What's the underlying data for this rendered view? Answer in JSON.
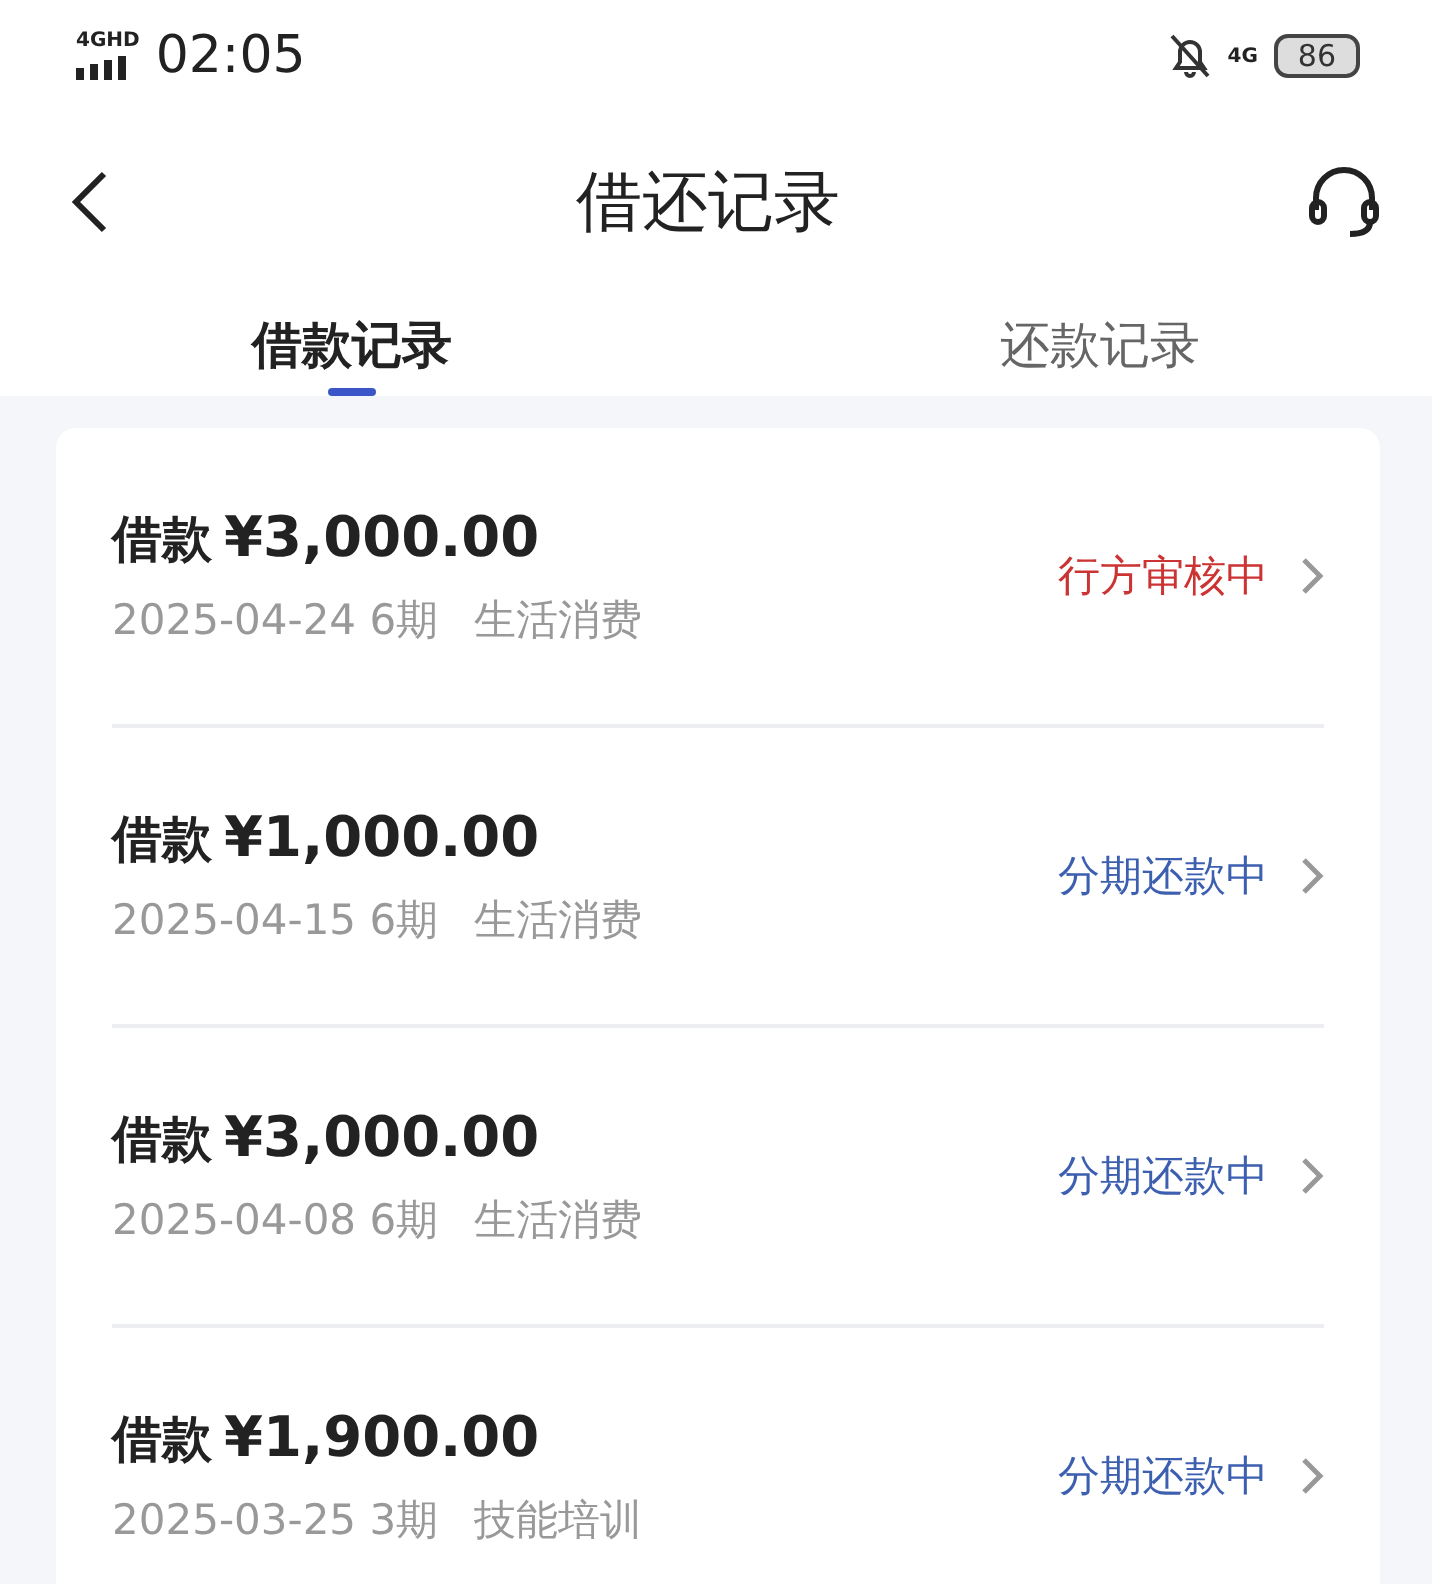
{
  "status_bar": {
    "network": "4GHD",
    "time": "02:05",
    "mobile": "4G",
    "battery": "86"
  },
  "header": {
    "title": "借还记录"
  },
  "tabs": [
    {
      "label": "借款记录",
      "selected": true
    },
    {
      "label": "还款记录",
      "selected": false
    }
  ],
  "records": [
    {
      "label": "借款",
      "amount": "¥3,000.00",
      "date_term": "2025-04-24 6期",
      "purpose": "生活消费",
      "status": "行方审核中",
      "color": "#cc3333"
    },
    {
      "label": "借款",
      "amount": "¥1,000.00",
      "date_term": "2025-04-15 6期",
      "purpose": "生活消费",
      "status": "分期还款中",
      "color": "#3d5fb0"
    },
    {
      "label": "借款",
      "amount": "¥3,000.00",
      "date_term": "2025-04-08 6期",
      "purpose": "生活消费",
      "status": "分期还款中",
      "color": "#3d5fb0"
    },
    {
      "label": "借款",
      "amount": "¥1,900.00",
      "date_term": "2025-03-25 3期",
      "purpose": "技能培训",
      "status": "分期还款中",
      "color": "#3d5fb0"
    }
  ]
}
